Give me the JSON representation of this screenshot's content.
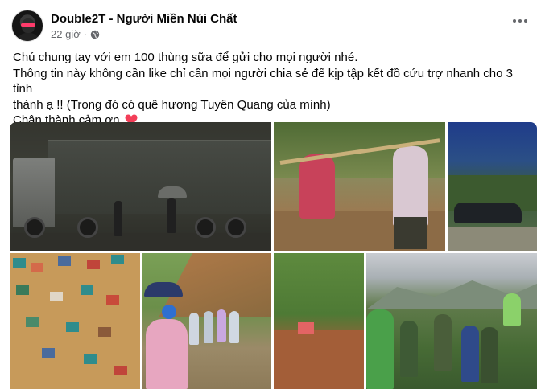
{
  "post": {
    "author": "Double2T - Người Miền Núi Chất",
    "time": "22 giờ",
    "separator": "·",
    "privacy_icon": "globe-icon",
    "more_icon": "more-horizontal-icon",
    "text": {
      "line1": "Chú chung tay với em 100 thùng sữa để gửi cho mọi người nhé.",
      "line2": "Thông tin này không cần like chỉ cần mọi người chia sẻ để kịp tập kết đồ cứu trợ nhanh cho 3 tỉnh",
      "line3": "thành ạ !! (Trong đó có quê hương Tuyên Quang của mình)",
      "line4": "Chân thành cảm ơn",
      "emoji": "heart-icon"
    },
    "colors": {
      "text": "#050505",
      "secondary": "#65676b",
      "heart": "#f33e58"
    },
    "photos": [
      "photo-truck-night",
      "photo-carrying-pole",
      "photo-car-under-tree",
      "photo-flooded-village",
      "photo-landslide-people",
      "photo-landslide-road",
      "photo-soldiers-clearing"
    ]
  }
}
